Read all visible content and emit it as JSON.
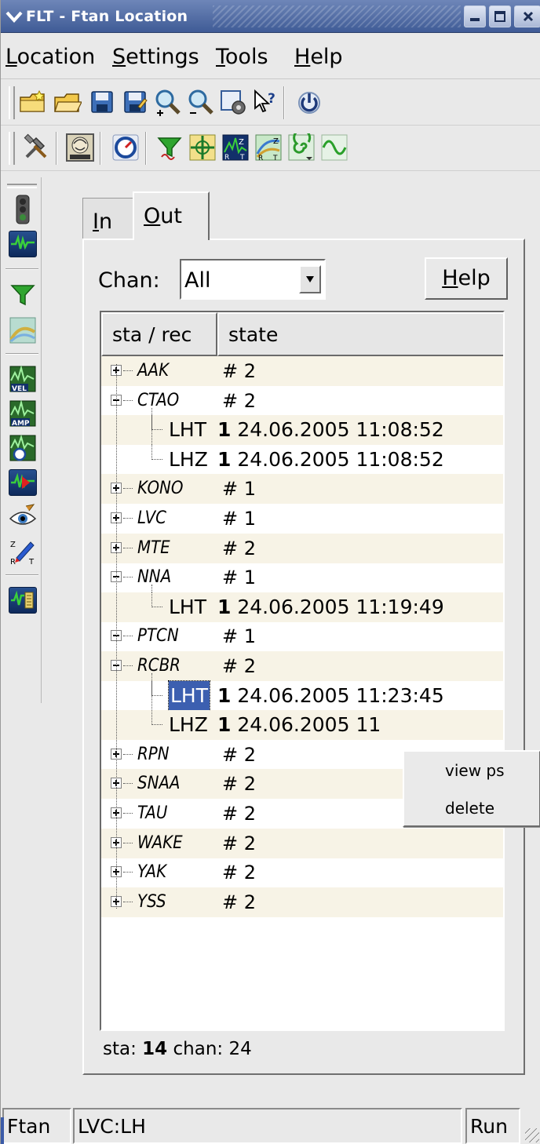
{
  "window": {
    "title": "FLT - Ftan Location"
  },
  "menubar": {
    "items": [
      {
        "pre": "",
        "ul": "L",
        "post": "ocation"
      },
      {
        "pre": "",
        "ul": "S",
        "post": "ettings"
      },
      {
        "pre": "",
        "ul": "T",
        "post": "ools"
      },
      {
        "pre": "",
        "ul": "H",
        "post": "elp"
      }
    ]
  },
  "toolbar1": [
    "new-folder-icon",
    "open-folder-icon",
    "save-icon",
    "save-as-icon",
    "zoom-in-icon",
    "zoom-out-icon",
    "settings-refresh-icon",
    "whats-this-icon",
    "power-icon"
  ],
  "toolbar2": [
    "tools-icon",
    "station-map-icon",
    "compass-icon",
    "filter-icon",
    "crosshair-icon",
    "zrt-icon",
    "zrt-alt-icon",
    "spiral-icon",
    "sine-wave-icon"
  ],
  "sidebar": [
    "traffic-light-icon",
    "seismogram-icon",
    "filter-icon",
    "dispersion-icon",
    "vel-icon",
    "amp-icon",
    "compass-tool-icon",
    "red-seismogram-icon",
    "eye-icon",
    "zrt-pen-icon",
    "record-icon"
  ],
  "tabs": {
    "in": {
      "ul": "I",
      "rest": "n"
    },
    "out": {
      "ul": "O",
      "rest": "ut"
    }
  },
  "chan": {
    "label": "Chan:",
    "value": "All"
  },
  "help_button": {
    "ul": "H",
    "rest": "elp"
  },
  "tree": {
    "columns": [
      "sta / rec",
      "state"
    ],
    "rows": [
      {
        "type": "sta",
        "sta": "AAK",
        "state": "# 2",
        "expanded": false
      },
      {
        "type": "sta",
        "sta": "CTAO",
        "state": "# 2",
        "expanded": true
      },
      {
        "type": "chan",
        "chan": "LHT",
        "n": "1",
        "datetime": "24.06.2005 11:08:52"
      },
      {
        "type": "chan",
        "chan": "LHZ",
        "n": "1",
        "datetime": "24.06.2005 11:08:52"
      },
      {
        "type": "sta",
        "sta": "KONO",
        "state": "# 1",
        "expanded": false
      },
      {
        "type": "sta",
        "sta": "LVC",
        "state": "# 1",
        "expanded": false
      },
      {
        "type": "sta",
        "sta": "MTE",
        "state": "# 2",
        "expanded": false
      },
      {
        "type": "sta",
        "sta": "NNA",
        "state": "# 1",
        "expanded": true
      },
      {
        "type": "chan",
        "chan": "LHT",
        "n": "1",
        "datetime": "24.06.2005 11:19:49"
      },
      {
        "type": "sta",
        "sta": "PTCN",
        "state": "# 1",
        "expanded": false,
        "leaf": true
      },
      {
        "type": "sta",
        "sta": "RCBR",
        "state": "# 2",
        "expanded": true
      },
      {
        "type": "chan",
        "chan": "LHT",
        "n": "1",
        "datetime": "24.06.2005 11:23:45",
        "selected": true
      },
      {
        "type": "chan",
        "chan": "LHZ",
        "n": "1",
        "datetime": "24.06.2005 11"
      },
      {
        "type": "sta",
        "sta": "RPN",
        "state": "# 2",
        "expanded": false
      },
      {
        "type": "sta",
        "sta": "SNAA",
        "state": "# 2",
        "expanded": false
      },
      {
        "type": "sta",
        "sta": "TAU",
        "state": "# 2",
        "expanded": false
      },
      {
        "type": "sta",
        "sta": "WAKE",
        "state": "# 2",
        "expanded": false
      },
      {
        "type": "sta",
        "sta": "YAK",
        "state": "# 2",
        "expanded": false
      },
      {
        "type": "sta",
        "sta": "YSS",
        "state": "# 2",
        "expanded": false
      }
    ]
  },
  "summary": {
    "sta_label": "sta:",
    "sta_count": "14",
    "chan_label": "chan:",
    "chan_count": "24"
  },
  "context_menu": {
    "items": [
      "view ps",
      "delete"
    ]
  },
  "statusbar": {
    "mode": "Ftan",
    "station": "LVC:LH",
    "state": "Run"
  },
  "colors": {
    "titlebar": "#4a66a3",
    "selection": "#3c5fb0",
    "row_shade": "#f7f3e6"
  }
}
